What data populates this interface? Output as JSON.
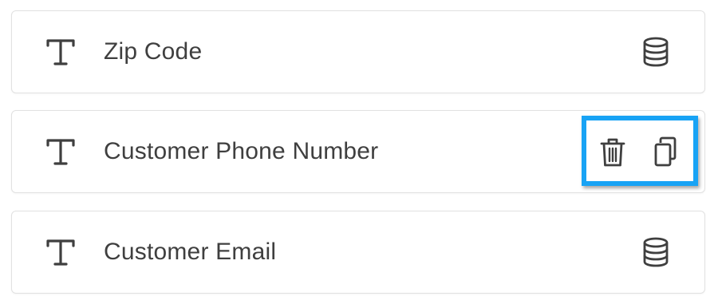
{
  "fields": [
    {
      "label": "Zip Code",
      "type_icon": "text-type-icon",
      "action_icon": "database-icon"
    },
    {
      "label": "Customer Phone Number",
      "type_icon": "text-type-icon",
      "actions": [
        "trash-icon",
        "copy-icon"
      ]
    },
    {
      "label": "Customer Email",
      "type_icon": "text-type-icon",
      "action_icon": "database-icon"
    }
  ],
  "colors": {
    "text": "#3f3f3f",
    "icon": "#3f3f3f",
    "border": "#e1e1e1",
    "highlight": "#18a3f5"
  }
}
